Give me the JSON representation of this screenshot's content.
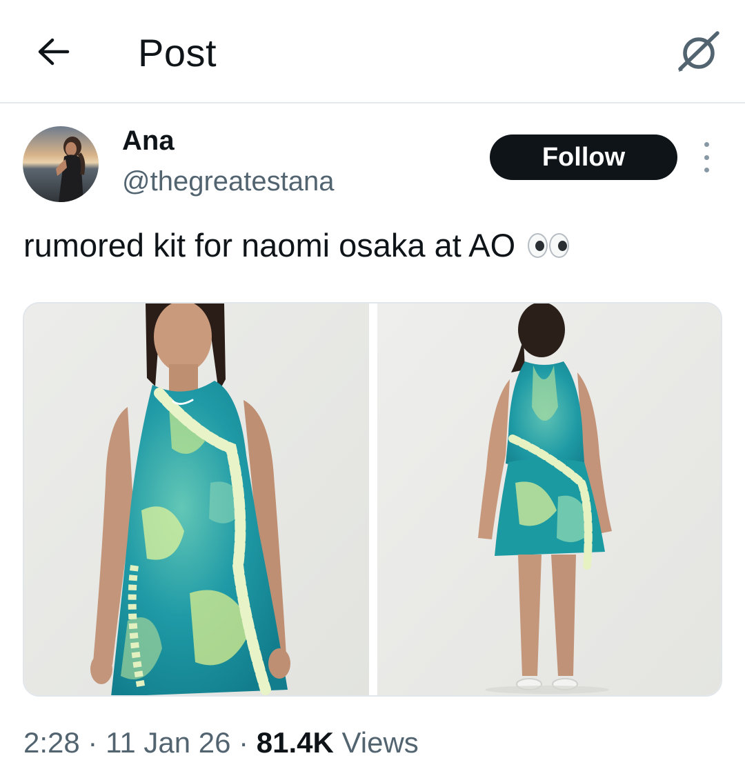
{
  "header": {
    "title": "Post",
    "back_icon": "arrow-left-icon",
    "grok_icon": "grok-slash-icon"
  },
  "author": {
    "display_name": "Ana",
    "handle": "@thegreatestana",
    "follow_label": "Follow"
  },
  "post": {
    "text": "rumored kit for naomi osaka at AO",
    "emoji": "eyes-emoji",
    "images": [
      {
        "description_icon": "photo-front-view",
        "alt": "Woman wearing teal and lime tie-dye ruffled tennis dress, front view"
      },
      {
        "description_icon": "photo-back-view",
        "alt": "Woman wearing teal and lime tie-dye ruffled tennis dress, back view"
      }
    ]
  },
  "meta": {
    "time": "2:28",
    "sep1": " · ",
    "date": "11 Jan 26",
    "sep2": " · ",
    "views_count": "81.4K",
    "views_label": " Views"
  },
  "colors": {
    "text_primary": "#0f1419",
    "text_secondary": "#536471",
    "button_bg": "#0f1419",
    "border": "#e6e9ec",
    "dress_teal": "#1aa3a8",
    "dress_lime": "#d7ee9a"
  }
}
